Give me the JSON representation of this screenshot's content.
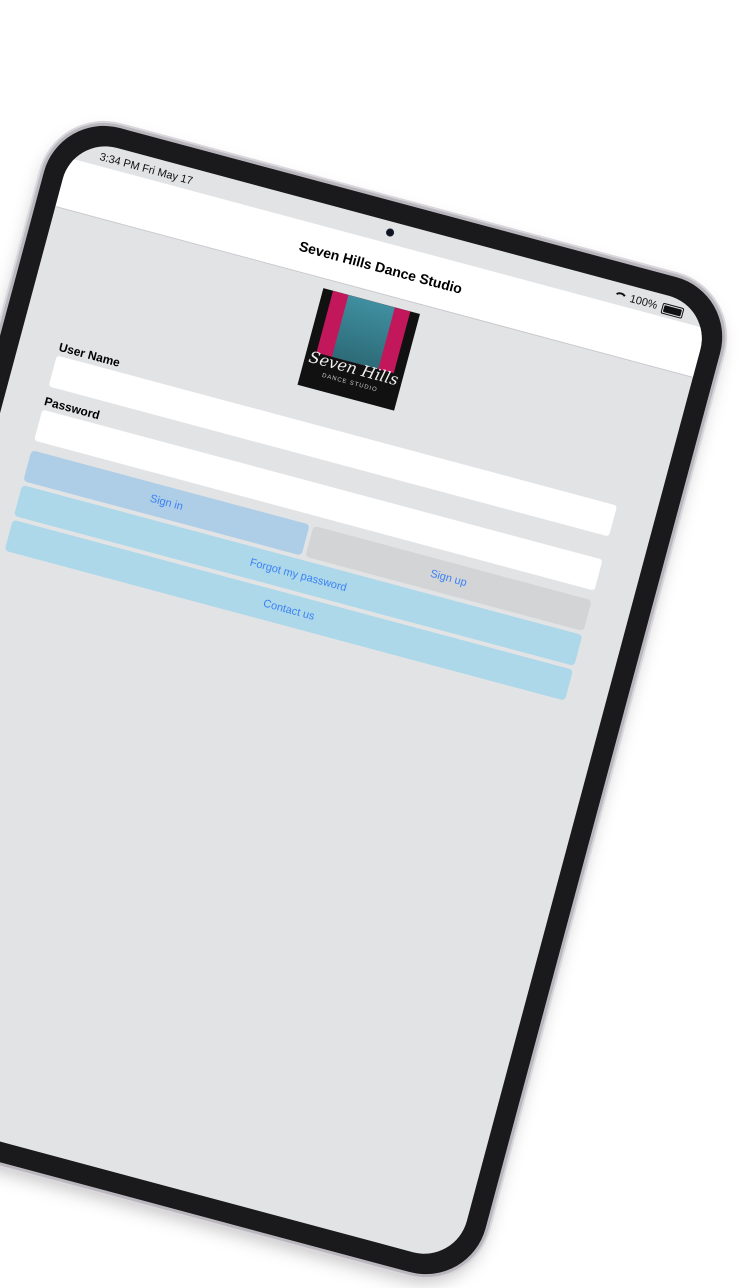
{
  "status": {
    "time": "3:34 PM   Fri May 17",
    "battery": "100%"
  },
  "nav": {
    "title": "Seven Hills Dance Studio"
  },
  "logo": {
    "script": "Seven Hills",
    "sub": "DANCE STUDIO"
  },
  "form": {
    "username_label": "User Name",
    "username_value": "",
    "password_label": "Password",
    "password_value": ""
  },
  "buttons": {
    "sign_in": "Sign in",
    "sign_up": "Sign up",
    "forgot": "Forgot my password",
    "contact": "Contact us"
  },
  "colors": {
    "screen_bg": "#e2e3e5",
    "link": "#3b82f6",
    "sign_in_bg": "#aecde6",
    "sign_up_bg": "#d3d4d6",
    "wide_bg": "#add8e9",
    "logo_pink": "#c2185b",
    "logo_teal": "#3f8fa0"
  }
}
